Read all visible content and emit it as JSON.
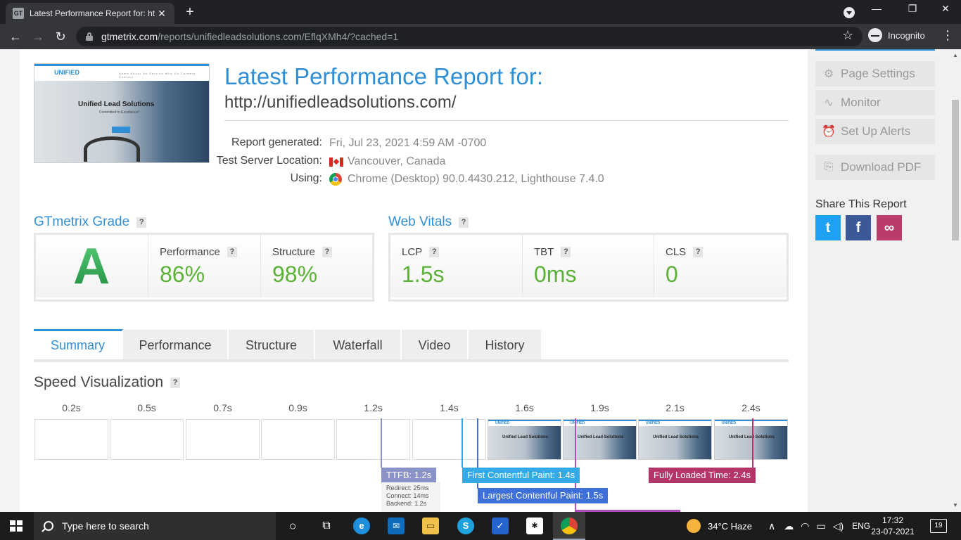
{
  "browser": {
    "tab_favicon": "GT",
    "tab_title": "Latest Performance Report for: ht",
    "url_host": "gtmetrix.com",
    "url_path": "/reports/unifiedleadsolutions.com/EflqXMh4/?cached=1",
    "incognito_label": "Incognito"
  },
  "report": {
    "title": "Latest Performance Report for:",
    "url": "http://unifiedleadsolutions.com/",
    "meta": [
      {
        "label": "Report generated:",
        "value": "Fri, Jul 23, 2021 4:59 AM -0700"
      },
      {
        "label": "Test Server Location:",
        "value": "Vancouver, Canada"
      },
      {
        "label": "Using:",
        "value": "Chrome (Desktop) 90.0.4430.212, Lighthouse 7.4.0"
      }
    ],
    "thumbnail": {
      "logo": "UNIFIED",
      "nav": "Home  About Us  Service  Why Us  Careers  Contact",
      "headline": "Unified Lead Solutions",
      "tagline": "Committed to Excellence!",
      "button": "About Us"
    }
  },
  "grade": {
    "heading": "GTmetrix Grade",
    "help": "?",
    "letter": "A",
    "performance_label": "Performance",
    "performance_value": "86%",
    "structure_label": "Structure",
    "structure_value": "98%"
  },
  "vitals": {
    "heading": "Web Vitals",
    "help": "?",
    "lcp_label": "LCP",
    "lcp_value": "1.5s",
    "tbt_label": "TBT",
    "tbt_value": "0ms",
    "cls_label": "CLS",
    "cls_value": "0"
  },
  "tabs": [
    "Summary",
    "Performance",
    "Structure",
    "Waterfall",
    "Video",
    "History"
  ],
  "speed_viz": {
    "title": "Speed Visualization",
    "help": "?",
    "frame_times": [
      "0.2s",
      "0.5s",
      "0.7s",
      "0.9s",
      "1.2s",
      "1.4s",
      "1.6s",
      "1.9s",
      "2.1s",
      "2.4s"
    ],
    "frame_caption": "Unified Lead Solutions",
    "frame_logo": "UNIFIED",
    "markers": {
      "ttfb": "TTFB: 1.2s",
      "fcp": "First Contentful Paint: 1.4s",
      "lcp": "Largest Contentful Paint: 1.5s",
      "fully_loaded": "Fully Loaded Time: 2.4s"
    },
    "ttfb_detail": [
      "Redirect: 25ms",
      "Connect: 14ms",
      "Backend: 1.2s"
    ]
  },
  "sidebar": {
    "buttons": [
      "Page Settings",
      "Monitor",
      "Set Up Alerts",
      "Download PDF"
    ],
    "share_title": "Share This Report",
    "share_buttons": [
      "t",
      "f",
      "∞"
    ]
  },
  "taskbar": {
    "search_placeholder": "Type here to search",
    "weather": "34°C  Haze",
    "language": "ENG",
    "time": "17:32",
    "date": "23-07-2021",
    "notifications": "19"
  },
  "colors": {
    "accent": "#2f8fd6",
    "good": "#5cb137",
    "ttfb": "#8a93c8",
    "fcp": "#33a9e6",
    "lcp": "#3f6fd8",
    "fully_loaded": "#b4356a"
  }
}
